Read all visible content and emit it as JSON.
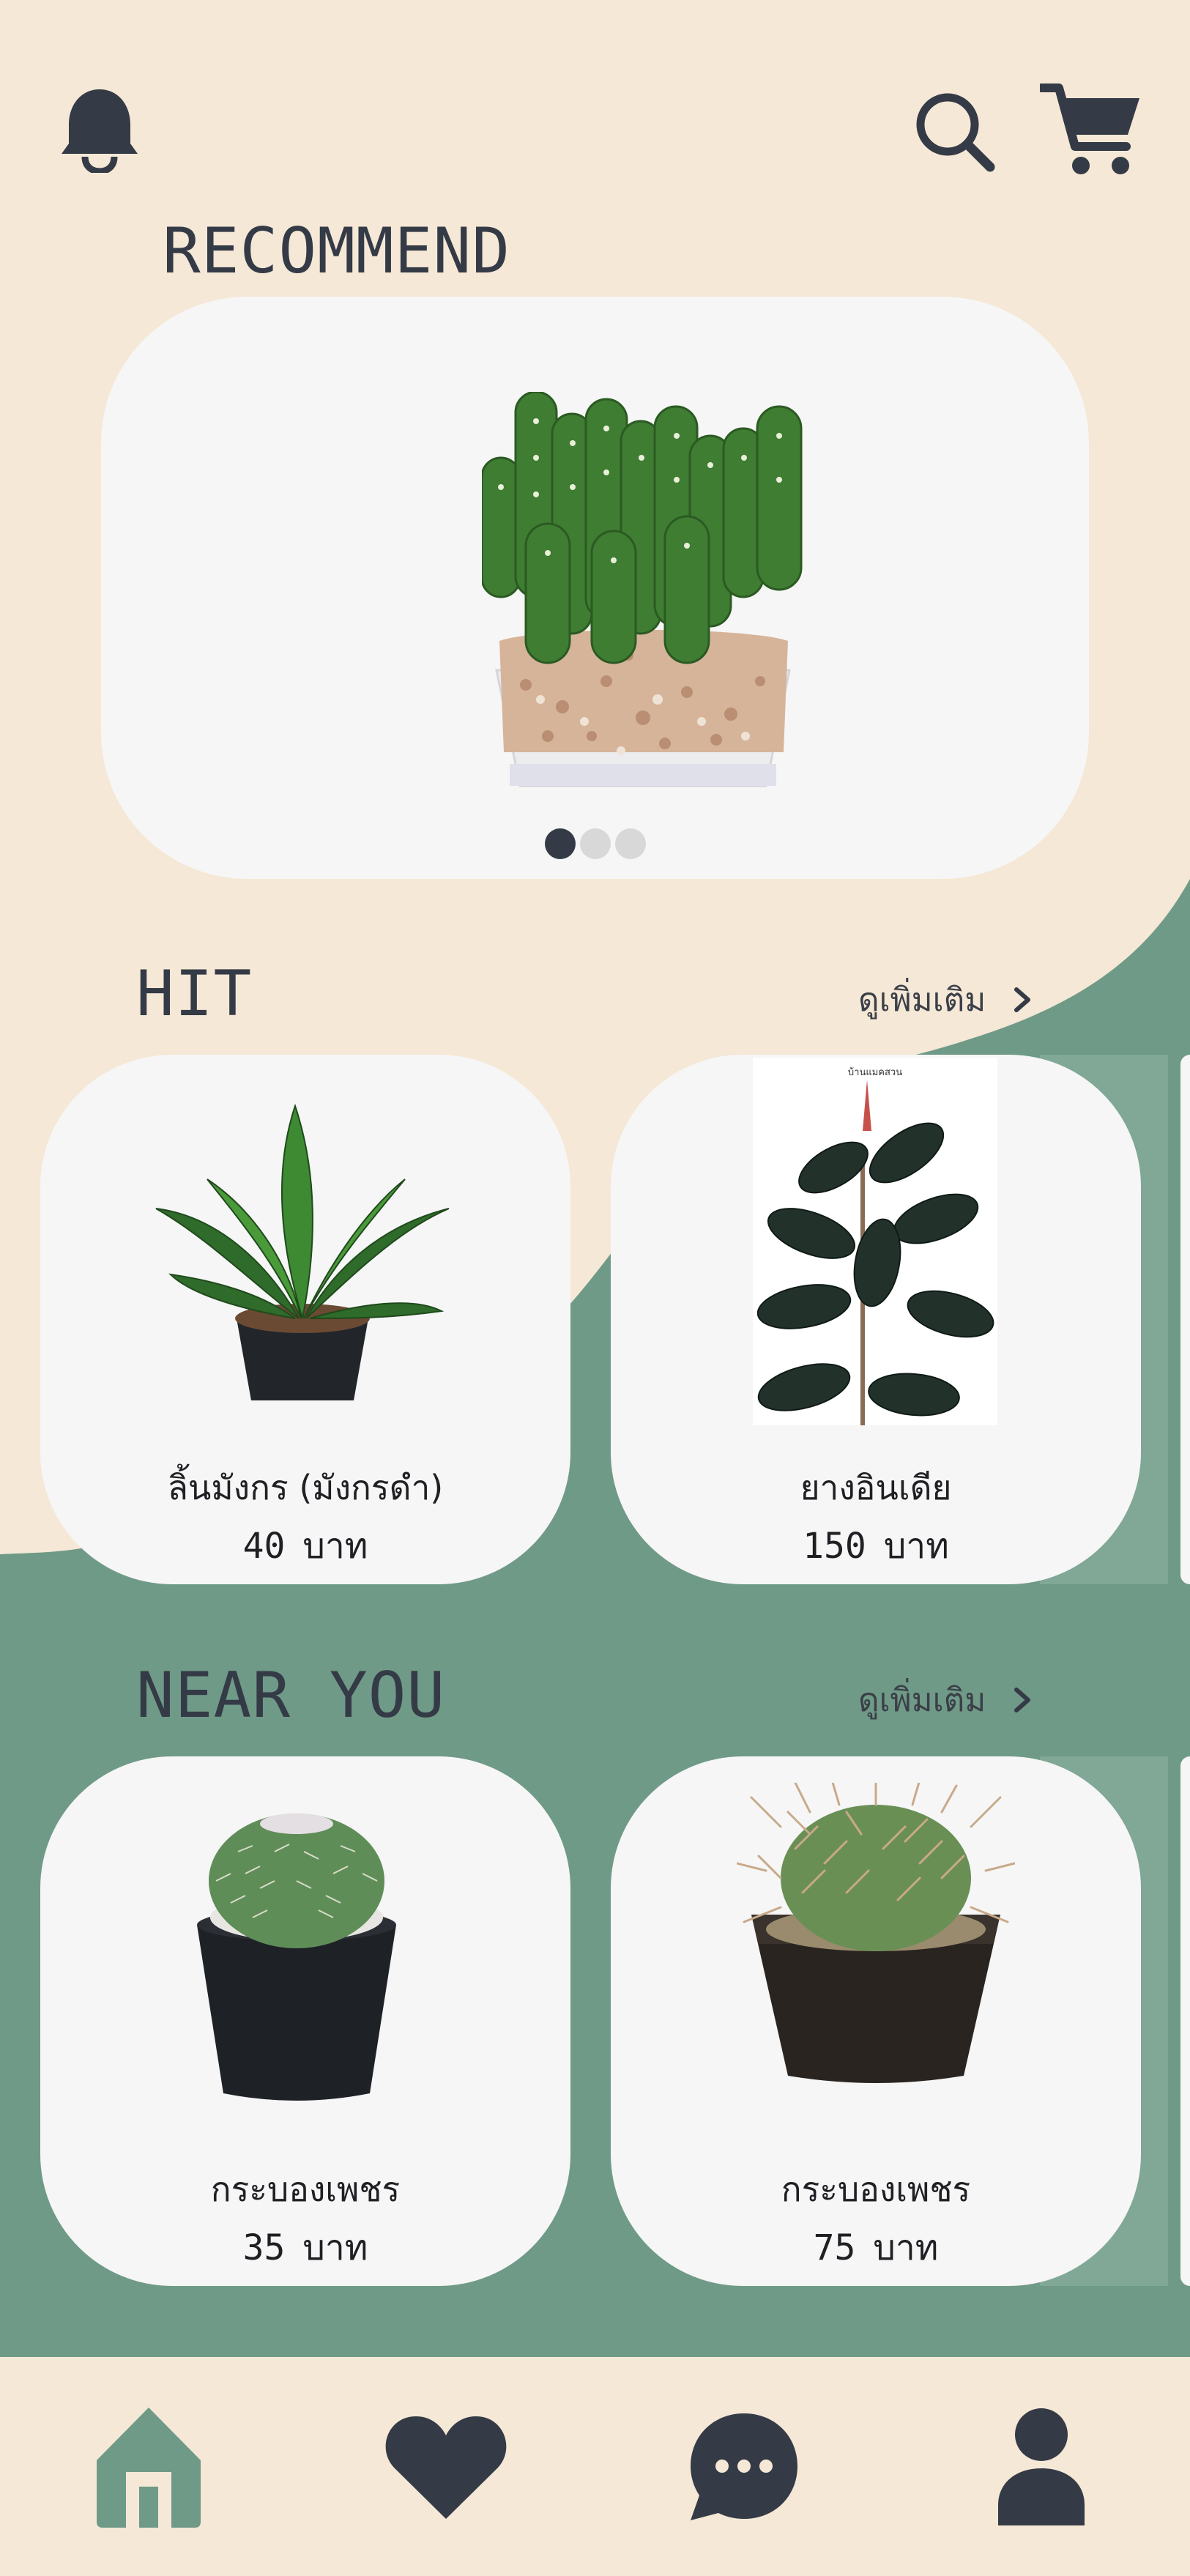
{
  "colors": {
    "cream": "#f5e8d6",
    "green": "#6f9a87",
    "card": "#f6f6f6",
    "dark": "#343a46",
    "active_nav": "#6f9a87"
  },
  "header": {
    "icons": [
      "bell-icon",
      "search-icon",
      "cart-icon"
    ]
  },
  "recommend": {
    "title": "RECOMMEND",
    "slides_total": 3,
    "active_slide": 1
  },
  "hit": {
    "title": "HIT",
    "see_more": "ดูเพิ่มเติม",
    "items": [
      {
        "name": "ลิ้นมังกร (มังกรดำ)",
        "price": "40",
        "unit": "บาท"
      },
      {
        "name": "ยางอินเดีย",
        "price": "150",
        "unit": "บาท",
        "photo_caption": "บ้านแมคสวน"
      }
    ]
  },
  "near_you": {
    "title": "NEAR YOU",
    "see_more": "ดูเพิ่มเติม",
    "items": [
      {
        "name": "กระบองเพชร",
        "price": "35",
        "unit": "บาท"
      },
      {
        "name": "กระบองเพชร",
        "price": "75",
        "unit": "บาท"
      }
    ]
  },
  "bottom_nav": {
    "items": [
      "home-icon",
      "heart-icon",
      "chat-icon",
      "profile-icon"
    ],
    "active": "home-icon"
  }
}
